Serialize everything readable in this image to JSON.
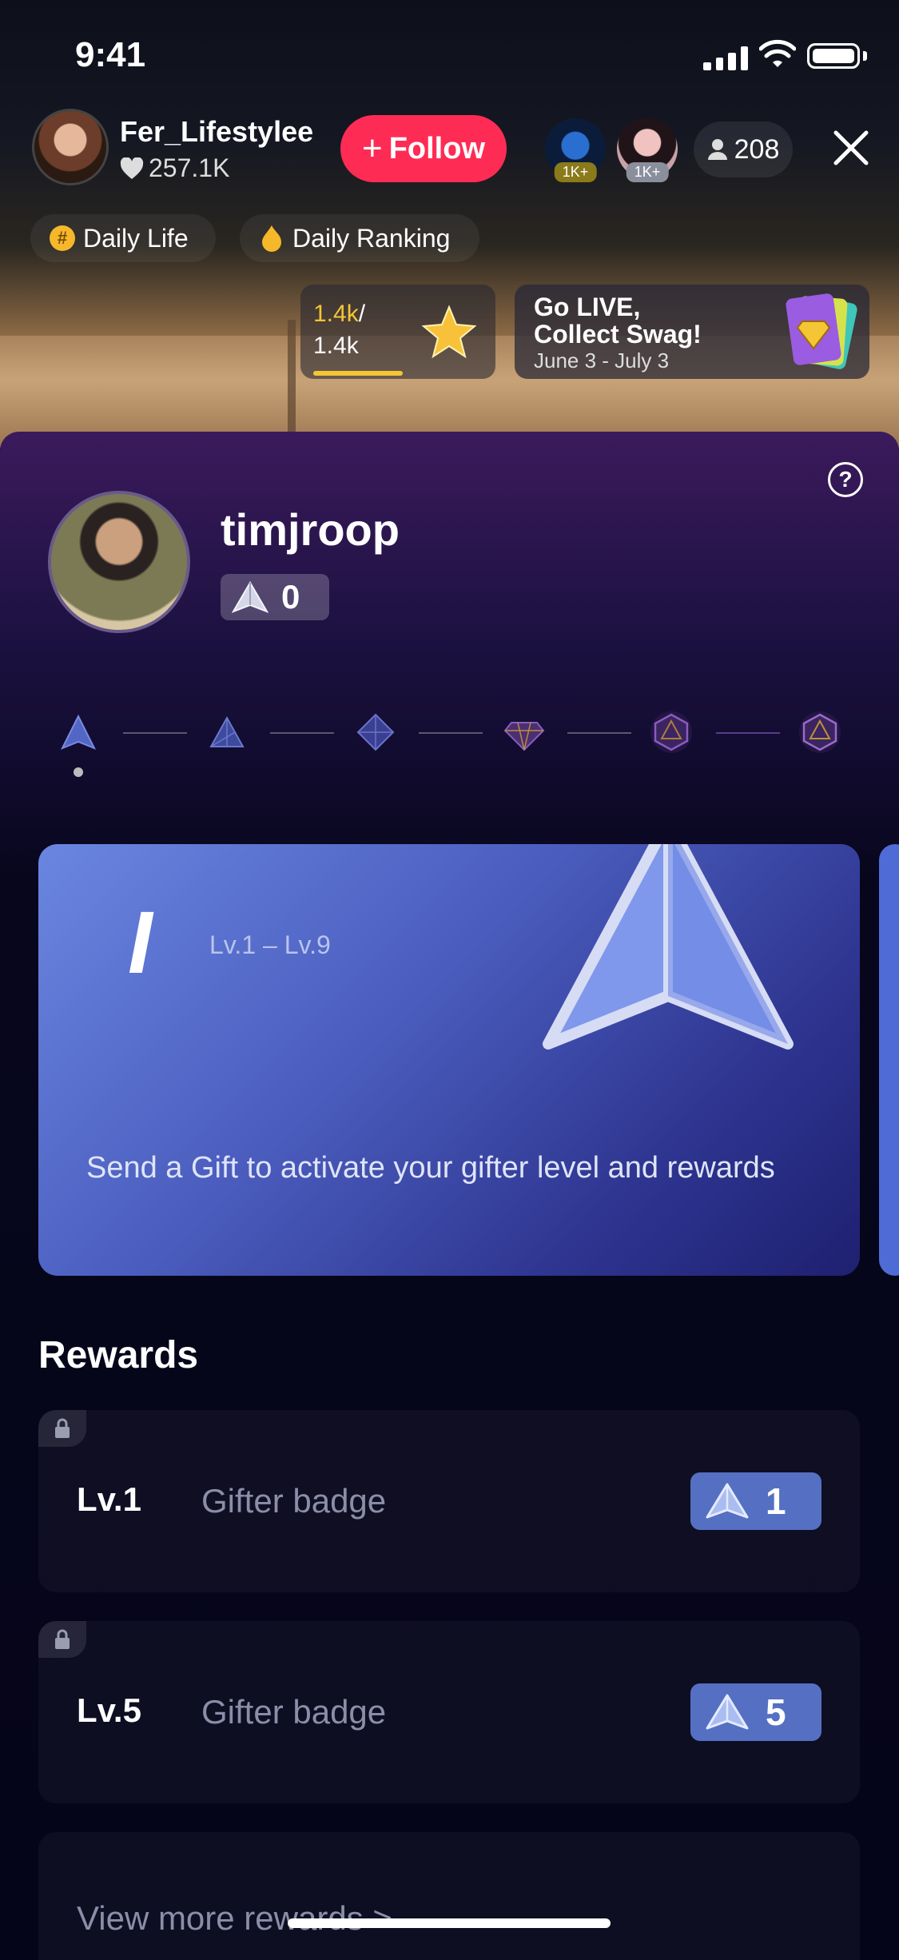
{
  "status_bar": {
    "time": "9:41"
  },
  "host": {
    "name": "Fer_Lifestylee",
    "likes": "257.1K",
    "follow_label": "Follow"
  },
  "viewers": {
    "badge1": "1K+",
    "badge2": "1K+",
    "count": "208"
  },
  "chips": [
    {
      "icon": "hashtag-icon",
      "label": "Daily Life"
    },
    {
      "icon": "flame-icon",
      "label": "Daily Ranking"
    }
  ],
  "ranking": {
    "current": "1.4k",
    "total": "1.4k"
  },
  "promo": {
    "line1": "Go LIVE,",
    "line2": "Collect Swag!",
    "dates": "June 3 - July 3"
  },
  "profile": {
    "username": "timjroop",
    "level_value": "0"
  },
  "level_card": {
    "roman": "I",
    "range": "Lv.1 – Lv.9",
    "description": "Send a Gift to activate your gifter level and rewards"
  },
  "rewards": {
    "title": "Rewards",
    "items": [
      {
        "level": "Lv.1",
        "name": "Gifter badge",
        "badge_value": "1"
      },
      {
        "level": "Lv.5",
        "name": "Gifter badge",
        "badge_value": "5"
      }
    ],
    "view_more": "View more rewards >"
  },
  "colors": {
    "follow": "#fe2c55",
    "accent_gold": "#f5c634",
    "badge_blue": "#5570c2"
  }
}
